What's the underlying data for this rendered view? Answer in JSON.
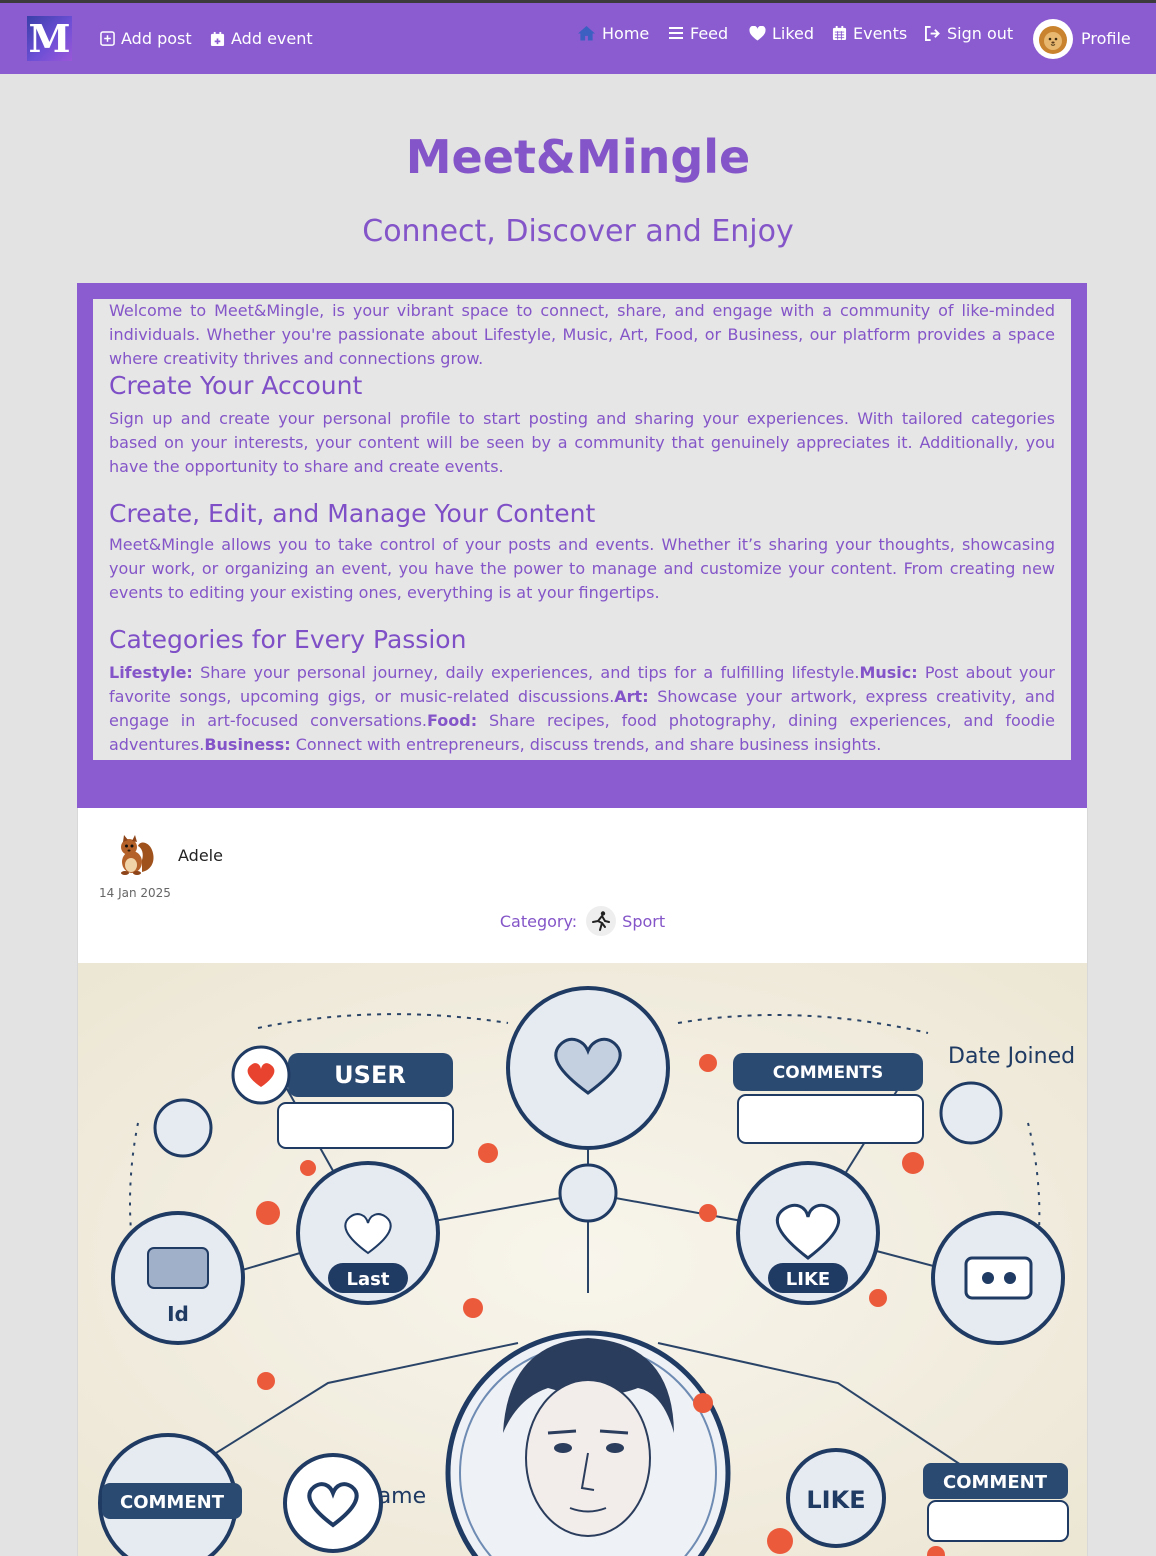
{
  "navbar": {
    "logo_letter": "M",
    "add_post": "Add post",
    "add_event": "Add event",
    "home": "Home",
    "feed": "Feed",
    "liked": "Liked",
    "events": "Events",
    "sign_out": "Sign out",
    "profile": "Profile"
  },
  "hero": {
    "title": "Meet&Mingle",
    "subtitle": "Connect, Discover and Enjoy"
  },
  "about": {
    "intro": "Welcome to Meet&Mingle, is your vibrant space to connect, share, and engage with a community of like-minded individuals. Whether you're passionate about Lifestyle, Music, Art, Food, or Business, our platform provides a space where creativity thrives and connections grow.",
    "section1_heading": "Create Your Account",
    "section1_text": "Sign up and create your personal profile to start posting and sharing your experiences. With tailored categories based on your interests, your content will be seen by a community that genuinely appreciates it. Additionally, you have the opportunity to share and create events.",
    "section2_heading": "Create, Edit, and Manage Your Content",
    "section2_text": "Meet&Mingle allows you to take control of your posts and events. Whether it’s sharing your thoughts, showcasing your work, or organizing an event, you have the power to manage and customize your content. From creating new events to editing your existing ones, everything is at your fingertips.",
    "section3_heading": "Categories for Every Passion",
    "categories": [
      {
        "label": "Lifestyle:",
        "text": " Share your personal journey, daily experiences, and tips for a fulfilling lifestyle."
      },
      {
        "label": "Music:",
        "text": " Post about your favorite songs, upcoming gigs, or music-related discussions."
      },
      {
        "label": "Art:",
        "text": " Showcase your artwork, express creativity, and engage in art-focused conversations."
      },
      {
        "label": "Food:",
        "text": " Share recipes, food photography, dining experiences, and foodie adventures."
      },
      {
        "label": "Business:",
        "text": " Connect with entrepreneurs, discuss trends, and share business insights."
      }
    ]
  },
  "post": {
    "username": "Adele",
    "date": "14 Jan 2025",
    "category_label": "Category:",
    "category_name": "Sport",
    "image_labels": {
      "user": "USER",
      "comments": "COMMENTS",
      "date_joined": "Date Joined",
      "username": "Username",
      "comment": "COMMENT",
      "like": "LIKE",
      "last": "Last",
      "id": "Id"
    }
  },
  "colors": {
    "brand": "#8a5cd0",
    "text_accent": "#8455c8",
    "background": "#e3e3e3"
  }
}
